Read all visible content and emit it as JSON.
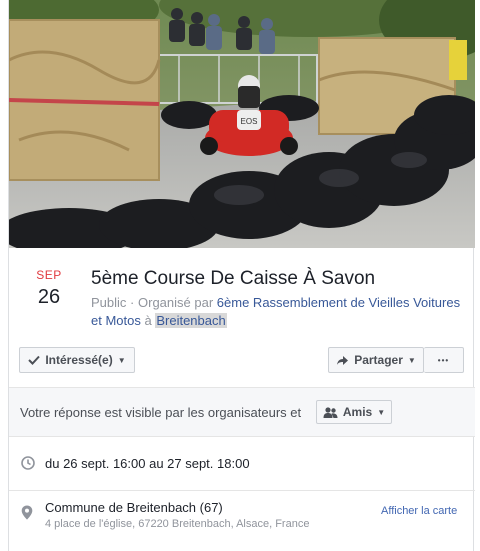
{
  "cover": {
    "car_number": "EOS",
    "colors": {
      "car": "#d22a25",
      "hay": "#c9b382",
      "bags": "#1c1d20",
      "road": "#b7b9ba",
      "trees": "#4f6b33"
    }
  },
  "event": {
    "month": "SEP",
    "day": "26",
    "title": "5ème Course De Caisse À Savon",
    "privacy": "Public",
    "separator": "·",
    "organized_by_label": "Organisé par",
    "organizer": "6ème Rassemblement de Vieilles Voitures et Motos",
    "preposition": "à",
    "town": "Breitenbach"
  },
  "actions": {
    "interested_label": "Intéressé(e)",
    "share_label": "Partager",
    "more_label": "•••"
  },
  "visibility": {
    "text": "Votre réponse est visible par les organisateurs et",
    "audience_label": "Amis"
  },
  "details": {
    "time_text": "du 26 sept. 16:00 au 27 sept. 18:00",
    "location_name": "Commune de Breitenbach (67)",
    "location_address": "4 place de l'église, 67220 Breitenbach, Alsace, France",
    "map_link": "Afficher la carte"
  },
  "colors": {
    "accent_month": "#e0393e",
    "link": "#385898",
    "muted_text": "#90949c",
    "button_bg": "#f6f7f9"
  },
  "icons": [
    "check-icon",
    "share-arrow-icon",
    "friends-icon",
    "clock-icon",
    "location-pin-icon",
    "chevron-down-icon"
  ]
}
